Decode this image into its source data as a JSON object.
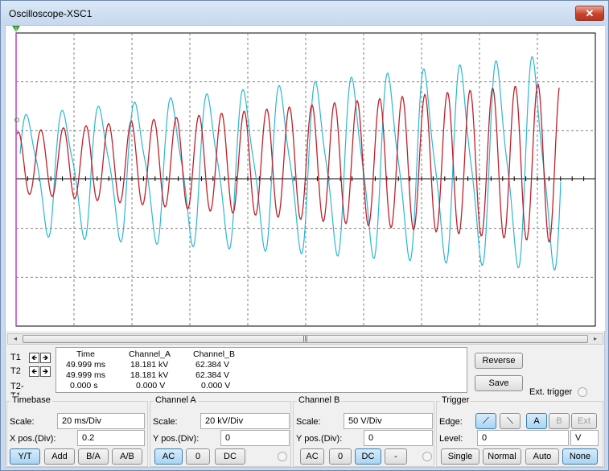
{
  "window": {
    "title": "Oscilloscope-XSC1",
    "close_glyph": "✕"
  },
  "colors": {
    "channel_a": "#c0202a",
    "channel_b": "#2cb6d4",
    "accent": "#3c7fb1",
    "grid_line": "#808080"
  },
  "waveform": {
    "grid": {
      "h_divisions": 10,
      "v_divisions": 6
    },
    "channel_a": {
      "color": "#c0202a",
      "cycles_approx": 24,
      "pattern": "sinusoid, rising amplitude"
    },
    "channel_b": {
      "color": "#2cb6d4",
      "cycles_approx": 15,
      "pattern": "distorted sinusoid, rising amplitude, larger negative peaks"
    },
    "cursor1_marker": "1"
  },
  "scrollbar": {
    "left_arrow": "◂",
    "right_arrow": "▸",
    "thumb_grip": "|||"
  },
  "cursors": {
    "t1_label": "T1",
    "t2_label": "T2",
    "diff_label": "T2-T1",
    "left_arrow": "🡸",
    "right_arrow": "🡺"
  },
  "readout": {
    "headers": {
      "time": "Time",
      "channel_a": "Channel_A",
      "channel_b": "Channel_B"
    },
    "rows": [
      {
        "time": "49.999 ms",
        "channel_a": "18.181 kV",
        "channel_b": "62.384 V"
      },
      {
        "time": "49.999 ms",
        "channel_a": "18.181 kV",
        "channel_b": "62.384 V"
      },
      {
        "time": "0.000 s",
        "channel_a": "0.000 V",
        "channel_b": "0.000 V"
      }
    ]
  },
  "side_buttons": {
    "reverse": "Reverse",
    "save": "Save",
    "ext_trigger": "Ext. trigger"
  },
  "timebase": {
    "title": "Timebase",
    "scale_label": "Scale:",
    "scale_value": "20 ms/Div",
    "xpos_label": "X pos.(Div):",
    "xpos_value": "0.2",
    "buttons": [
      "Y/T",
      "Add",
      "B/A",
      "A/B"
    ],
    "active": "Y/T"
  },
  "channel_a": {
    "title": "Channel A",
    "scale_label": "Scale:",
    "scale_value": "20 kV/Div",
    "ypos_label": "Y pos.(Div):",
    "ypos_value": "0",
    "buttons": [
      "AC",
      "0",
      "DC"
    ],
    "active": "AC"
  },
  "channel_b": {
    "title": "Channel B",
    "scale_label": "Scale:",
    "scale_value": "50  V/Div",
    "ypos_label": "Y pos.(Div):",
    "ypos_value": "0",
    "buttons": [
      "AC",
      "0",
      "DC",
      "-"
    ],
    "active": "DC"
  },
  "trigger": {
    "title": "Trigger",
    "edge_label": "Edge:",
    "rising_glyph": "⟋",
    "falling_glyph": "⟍",
    "source_buttons": [
      "A",
      "B",
      "Ext"
    ],
    "active_source": "A",
    "level_label": "Level:",
    "level_value": "0",
    "level_unit": "V",
    "mode_buttons": [
      "Single",
      "Normal",
      "Auto",
      "None"
    ],
    "active_mode": "None"
  }
}
